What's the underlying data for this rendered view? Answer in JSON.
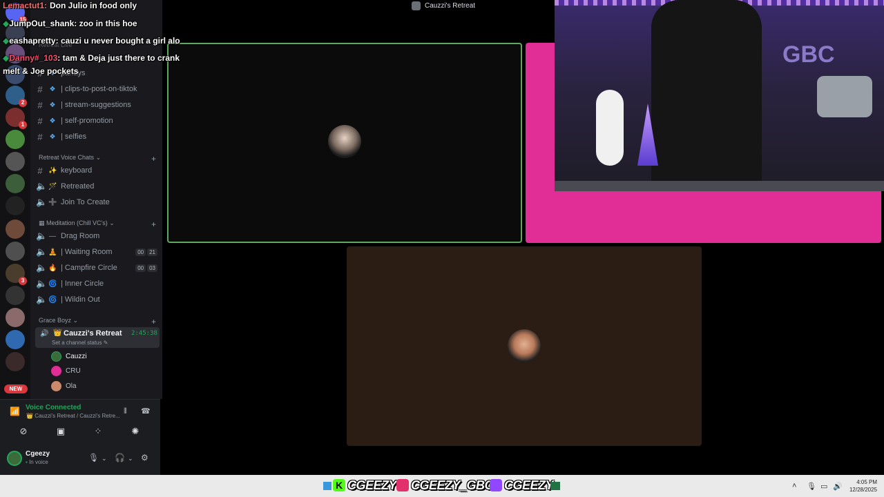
{
  "window": {
    "title": "Cauzzi's Retreat"
  },
  "chat": [
    {
      "user": "Lemactut1:",
      "user_color": "#ff6b6b",
      "message": "Don Julio in food only"
    },
    {
      "user": "JumpOut_shank",
      "user_color": "#ffffff",
      "message": ": zoo in this hoe"
    },
    {
      "user": "eashapretty",
      "user_color": "#ffffff",
      "message": ": cauzi u never bought a girl alo"
    },
    {
      "user": "Danny#_103",
      "user_color": "#ff4d6d",
      "message": ": tam & Deja just there to crank"
    },
    {
      "user": "",
      "user_color": "#ffffff",
      "message": "melt & Joe pockets"
    }
  ],
  "rail": {
    "badges": [
      "15",
      "2",
      "1",
      "3"
    ],
    "new_label": "NEW"
  },
  "sidebar": {
    "partial_header": "Retreat Live",
    "text_channels": [
      {
        "name": "parlays",
        "icon": "discord-badge-icon"
      },
      {
        "name": "| clips-to-post-on-tiktok",
        "icon": "discord-badge-icon"
      },
      {
        "name": "| stream-suggestions",
        "icon": "discord-badge-icon"
      },
      {
        "name": "| self-promotion",
        "icon": "discord-badge-icon"
      },
      {
        "name": "| selfies",
        "icon": "discord-badge-icon"
      }
    ],
    "cat_voice": "Retreat Voice Chats",
    "voice_channels": [
      {
        "name": "keyboard",
        "emoji": "✨",
        "type": "text"
      },
      {
        "name": "Retreated",
        "emoji": "🪄",
        "type": "voice"
      },
      {
        "name": "Join To Create",
        "emoji": "➕",
        "type": "voice"
      }
    ],
    "cat_meditation": "Meditation (Chill VC's)",
    "meditation_channels": [
      {
        "name": "Drag Room",
        "emoji": "—",
        "counts": []
      },
      {
        "name": "| Waiting Room",
        "emoji": "🧘",
        "counts": [
          "00",
          "21"
        ]
      },
      {
        "name": "| Campfire Circle",
        "emoji": "🔥",
        "counts": [
          "00",
          "03"
        ]
      },
      {
        "name": "| Inner Circle",
        "emoji": "🌀",
        "counts": []
      },
      {
        "name": "| Wildin Out",
        "emoji": "🌀",
        "counts": []
      }
    ],
    "cat_grace": "Grace Boyz",
    "active_channel": {
      "name": "Cauzzi's Retreat",
      "timer": "2:45:38",
      "status": "Set a channel status"
    },
    "voice_users": [
      "Cauzzi",
      "CRU",
      "Ola"
    ]
  },
  "voice_panel": {
    "status": "Voice Connected",
    "location": "Cauzzi's Retreat / Cauzzi's Retre...",
    "user": "Cgeezy",
    "user_status": "In voice"
  },
  "taskbar": {
    "socials": [
      "CGEEZY",
      "CGEEZY_GBC",
      "CGEEZY"
    ],
    "time": "4:05 PM",
    "date": "12/28/2025"
  },
  "colors": {
    "accent_green": "#5fa85f",
    "voice_green": "#23a55a",
    "pink_tile": "#e12d96",
    "brown_tile": "#2b1c14",
    "kick": "#53fc18",
    "instagram": "#e1306c",
    "twitch": "#9146ff"
  }
}
